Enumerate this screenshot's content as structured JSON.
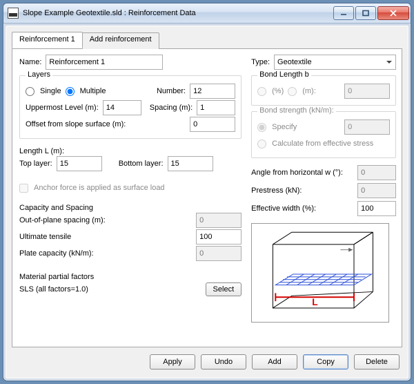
{
  "window": {
    "title": "Slope Example Geotextile.sld : Reinforcement Data"
  },
  "tabs": {
    "t1": "Reinforcement 1",
    "t2": "Add reinforcement"
  },
  "fields": {
    "name_label": "Name:",
    "name_value": "Reinforcement 1",
    "type_label": "Type:",
    "type_value": "Geotextile"
  },
  "layers": {
    "legend": "Layers",
    "single": "Single",
    "multiple": "Multiple",
    "number_label": "Number:",
    "number_value": "12",
    "upper_label": "Uppermost Level (m):",
    "upper_value": "14",
    "spacing_label": "Spacing (m):",
    "spacing_value": "1",
    "offset_label": "Offset from slope surface (m):",
    "offset_value": "0"
  },
  "length": {
    "legend": "Length L (m):",
    "top_label": "Top layer:",
    "top_value": "15",
    "bot_label": "Bottom layer:",
    "bot_value": "15"
  },
  "anchor": {
    "label": "Anchor force is applied as surface load"
  },
  "capacity": {
    "legend": "Capacity and Spacing",
    "oop_label": "Out-of-plane spacing (m):",
    "oop_value": "0",
    "ult_label": "Ultimate tensile",
    "ult_value": "100",
    "plate_label": "Plate capacity (kN/m):",
    "plate_value": "0"
  },
  "material": {
    "legend": "Material partial factors",
    "sls_label": "SLS (all factors=1.0)",
    "select_btn": "Select"
  },
  "bond": {
    "legend": "Bond Length b",
    "pct_label": "(%)",
    "pct_value": "0",
    "m_label": "(m):",
    "m_value": "0"
  },
  "bondstrength": {
    "legend": "Bond strength (kN/m):",
    "specify": "Specify",
    "specify_value": "0",
    "calc": "Calculate from effective stress"
  },
  "angle": {
    "label": "Angle from horizontal w (°):",
    "value": "0"
  },
  "prestress": {
    "label": "Prestress (kN):",
    "value": "0"
  },
  "effwidth": {
    "label": "Effective width (%):",
    "value": "100"
  },
  "diagram_L": "L",
  "buttons": {
    "apply": "Apply",
    "undo": "Undo",
    "add": "Add",
    "copy": "Copy",
    "delete": "Delete"
  }
}
